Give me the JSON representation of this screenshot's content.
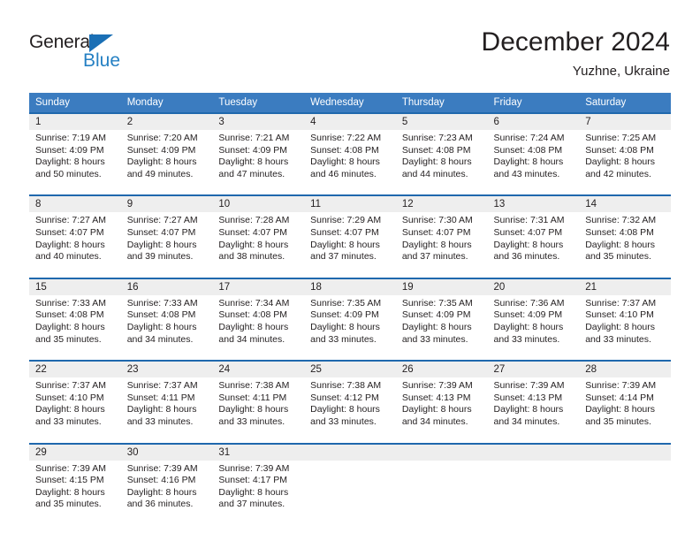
{
  "logo": {
    "word1": "General",
    "word2": "Blue",
    "triangle_color": "#1a6fb5",
    "word2_color": "#2580c3"
  },
  "header": {
    "title": "December 2024",
    "subtitle": "Yuzhne, Ukraine"
  },
  "theme": {
    "header_bg": "#3b7cc0",
    "header_text": "#ffffff",
    "separator": "#1f68ad",
    "daynum_bg": "#eeeeee",
    "text": "#231f20"
  },
  "calendar": {
    "weekdays": [
      "Sunday",
      "Monday",
      "Tuesday",
      "Wednesday",
      "Thursday",
      "Friday",
      "Saturday"
    ],
    "weeks": [
      {
        "days": [
          {
            "num": "1",
            "sunrise": "Sunrise: 7:19 AM",
            "sunset": "Sunset: 4:09 PM",
            "daylight1": "Daylight: 8 hours",
            "daylight2": "and 50 minutes."
          },
          {
            "num": "2",
            "sunrise": "Sunrise: 7:20 AM",
            "sunset": "Sunset: 4:09 PM",
            "daylight1": "Daylight: 8 hours",
            "daylight2": "and 49 minutes."
          },
          {
            "num": "3",
            "sunrise": "Sunrise: 7:21 AM",
            "sunset": "Sunset: 4:09 PM",
            "daylight1": "Daylight: 8 hours",
            "daylight2": "and 47 minutes."
          },
          {
            "num": "4",
            "sunrise": "Sunrise: 7:22 AM",
            "sunset": "Sunset: 4:08 PM",
            "daylight1": "Daylight: 8 hours",
            "daylight2": "and 46 minutes."
          },
          {
            "num": "5",
            "sunrise": "Sunrise: 7:23 AM",
            "sunset": "Sunset: 4:08 PM",
            "daylight1": "Daylight: 8 hours",
            "daylight2": "and 44 minutes."
          },
          {
            "num": "6",
            "sunrise": "Sunrise: 7:24 AM",
            "sunset": "Sunset: 4:08 PM",
            "daylight1": "Daylight: 8 hours",
            "daylight2": "and 43 minutes."
          },
          {
            "num": "7",
            "sunrise": "Sunrise: 7:25 AM",
            "sunset": "Sunset: 4:08 PM",
            "daylight1": "Daylight: 8 hours",
            "daylight2": "and 42 minutes."
          }
        ]
      },
      {
        "days": [
          {
            "num": "8",
            "sunrise": "Sunrise: 7:27 AM",
            "sunset": "Sunset: 4:07 PM",
            "daylight1": "Daylight: 8 hours",
            "daylight2": "and 40 minutes."
          },
          {
            "num": "9",
            "sunrise": "Sunrise: 7:27 AM",
            "sunset": "Sunset: 4:07 PM",
            "daylight1": "Daylight: 8 hours",
            "daylight2": "and 39 minutes."
          },
          {
            "num": "10",
            "sunrise": "Sunrise: 7:28 AM",
            "sunset": "Sunset: 4:07 PM",
            "daylight1": "Daylight: 8 hours",
            "daylight2": "and 38 minutes."
          },
          {
            "num": "11",
            "sunrise": "Sunrise: 7:29 AM",
            "sunset": "Sunset: 4:07 PM",
            "daylight1": "Daylight: 8 hours",
            "daylight2": "and 37 minutes."
          },
          {
            "num": "12",
            "sunrise": "Sunrise: 7:30 AM",
            "sunset": "Sunset: 4:07 PM",
            "daylight1": "Daylight: 8 hours",
            "daylight2": "and 37 minutes."
          },
          {
            "num": "13",
            "sunrise": "Sunrise: 7:31 AM",
            "sunset": "Sunset: 4:07 PM",
            "daylight1": "Daylight: 8 hours",
            "daylight2": "and 36 minutes."
          },
          {
            "num": "14",
            "sunrise": "Sunrise: 7:32 AM",
            "sunset": "Sunset: 4:08 PM",
            "daylight1": "Daylight: 8 hours",
            "daylight2": "and 35 minutes."
          }
        ]
      },
      {
        "days": [
          {
            "num": "15",
            "sunrise": "Sunrise: 7:33 AM",
            "sunset": "Sunset: 4:08 PM",
            "daylight1": "Daylight: 8 hours",
            "daylight2": "and 35 minutes."
          },
          {
            "num": "16",
            "sunrise": "Sunrise: 7:33 AM",
            "sunset": "Sunset: 4:08 PM",
            "daylight1": "Daylight: 8 hours",
            "daylight2": "and 34 minutes."
          },
          {
            "num": "17",
            "sunrise": "Sunrise: 7:34 AM",
            "sunset": "Sunset: 4:08 PM",
            "daylight1": "Daylight: 8 hours",
            "daylight2": "and 34 minutes."
          },
          {
            "num": "18",
            "sunrise": "Sunrise: 7:35 AM",
            "sunset": "Sunset: 4:09 PM",
            "daylight1": "Daylight: 8 hours",
            "daylight2": "and 33 minutes."
          },
          {
            "num": "19",
            "sunrise": "Sunrise: 7:35 AM",
            "sunset": "Sunset: 4:09 PM",
            "daylight1": "Daylight: 8 hours",
            "daylight2": "and 33 minutes."
          },
          {
            "num": "20",
            "sunrise": "Sunrise: 7:36 AM",
            "sunset": "Sunset: 4:09 PM",
            "daylight1": "Daylight: 8 hours",
            "daylight2": "and 33 minutes."
          },
          {
            "num": "21",
            "sunrise": "Sunrise: 7:37 AM",
            "sunset": "Sunset: 4:10 PM",
            "daylight1": "Daylight: 8 hours",
            "daylight2": "and 33 minutes."
          }
        ]
      },
      {
        "days": [
          {
            "num": "22",
            "sunrise": "Sunrise: 7:37 AM",
            "sunset": "Sunset: 4:10 PM",
            "daylight1": "Daylight: 8 hours",
            "daylight2": "and 33 minutes."
          },
          {
            "num": "23",
            "sunrise": "Sunrise: 7:37 AM",
            "sunset": "Sunset: 4:11 PM",
            "daylight1": "Daylight: 8 hours",
            "daylight2": "and 33 minutes."
          },
          {
            "num": "24",
            "sunrise": "Sunrise: 7:38 AM",
            "sunset": "Sunset: 4:11 PM",
            "daylight1": "Daylight: 8 hours",
            "daylight2": "and 33 minutes."
          },
          {
            "num": "25",
            "sunrise": "Sunrise: 7:38 AM",
            "sunset": "Sunset: 4:12 PM",
            "daylight1": "Daylight: 8 hours",
            "daylight2": "and 33 minutes."
          },
          {
            "num": "26",
            "sunrise": "Sunrise: 7:39 AM",
            "sunset": "Sunset: 4:13 PM",
            "daylight1": "Daylight: 8 hours",
            "daylight2": "and 34 minutes."
          },
          {
            "num": "27",
            "sunrise": "Sunrise: 7:39 AM",
            "sunset": "Sunset: 4:13 PM",
            "daylight1": "Daylight: 8 hours",
            "daylight2": "and 34 minutes."
          },
          {
            "num": "28",
            "sunrise": "Sunrise: 7:39 AM",
            "sunset": "Sunset: 4:14 PM",
            "daylight1": "Daylight: 8 hours",
            "daylight2": "and 35 minutes."
          }
        ]
      },
      {
        "days": [
          {
            "num": "29",
            "sunrise": "Sunrise: 7:39 AM",
            "sunset": "Sunset: 4:15 PM",
            "daylight1": "Daylight: 8 hours",
            "daylight2": "and 35 minutes."
          },
          {
            "num": "30",
            "sunrise": "Sunrise: 7:39 AM",
            "sunset": "Sunset: 4:16 PM",
            "daylight1": "Daylight: 8 hours",
            "daylight2": "and 36 minutes."
          },
          {
            "num": "31",
            "sunrise": "Sunrise: 7:39 AM",
            "sunset": "Sunset: 4:17 PM",
            "daylight1": "Daylight: 8 hours",
            "daylight2": "and 37 minutes."
          },
          {
            "num": "",
            "sunrise": "",
            "sunset": "",
            "daylight1": "",
            "daylight2": ""
          },
          {
            "num": "",
            "sunrise": "",
            "sunset": "",
            "daylight1": "",
            "daylight2": ""
          },
          {
            "num": "",
            "sunrise": "",
            "sunset": "",
            "daylight1": "",
            "daylight2": ""
          },
          {
            "num": "",
            "sunrise": "",
            "sunset": "",
            "daylight1": "",
            "daylight2": ""
          }
        ]
      }
    ]
  }
}
